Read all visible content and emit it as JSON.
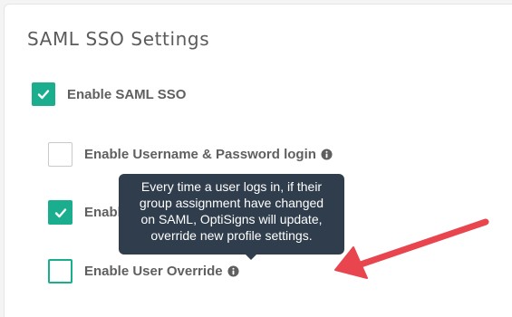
{
  "panel": {
    "title": "SAML SSO Settings"
  },
  "options": [
    {
      "label": "Enable SAML SSO",
      "checked": true
    },
    {
      "label": "Enable Username & Password login",
      "checked": false
    },
    {
      "label": "Enabl",
      "checked": true
    },
    {
      "label": "Enable User Override",
      "checked": false
    }
  ],
  "tooltip": {
    "lines": [
      "Every time a user logs in, if their",
      "group assignment have changed",
      "on SAML, OptiSigns will update,",
      "override new profile settings."
    ]
  },
  "colors": {
    "accent": "#1aae8f",
    "tooltip_bg": "#2f3d4c",
    "annotation_arrow": "#e8454f",
    "label": "#5f5f5f"
  },
  "icons": {
    "info": "info-icon",
    "check": "checkmark-icon",
    "annotation": "red-arrow-icon"
  }
}
